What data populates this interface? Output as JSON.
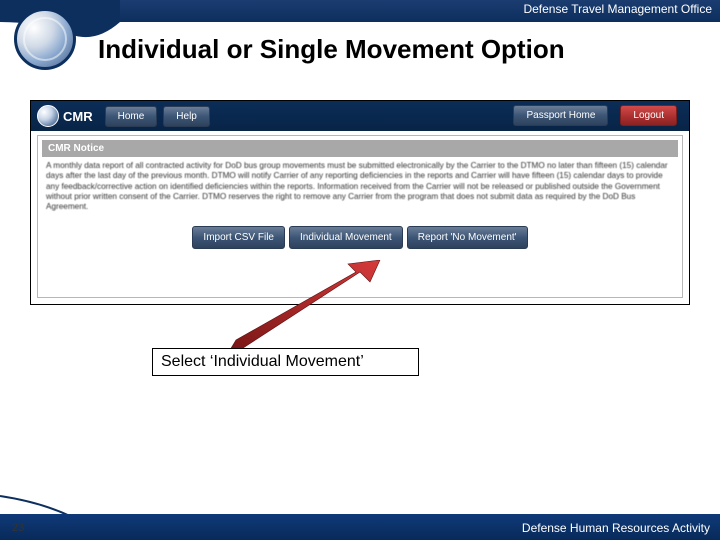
{
  "header": {
    "office": "Defense Travel Management Office",
    "title": "Individual or Single Movement Option"
  },
  "app": {
    "brand": "CMR",
    "nav": {
      "home": "Home",
      "help": "Help",
      "passport": "Passport Home",
      "logout": "Logout"
    },
    "notice_head": "CMR Notice",
    "notice_body": "A monthly data report of all contracted activity for DoD bus group movements must be submitted electronically by the Carrier to the DTMO no later than fifteen (15) calendar days after the last day of the previous month. DTMO will notify Carrier of any reporting deficiencies in the reports and Carrier will have fifteen (15) calendar days to provide any feedback/corrective action on identified deficiencies within the reports. Information received from the Carrier will not be released or published outside the Government without prior written consent of the Carrier. DTMO reserves the right to remove any Carrier from the program that does not submit data as required by the DoD Bus Agreement.",
    "buttons": {
      "import": "Import CSV File",
      "individual": "Individual Movement",
      "nomove": "Report 'No Movement'"
    }
  },
  "callout": {
    "text": "Select ‘Individual Movement’"
  },
  "footer": {
    "slide": "23",
    "org": "Defense Human Resources Activity"
  }
}
